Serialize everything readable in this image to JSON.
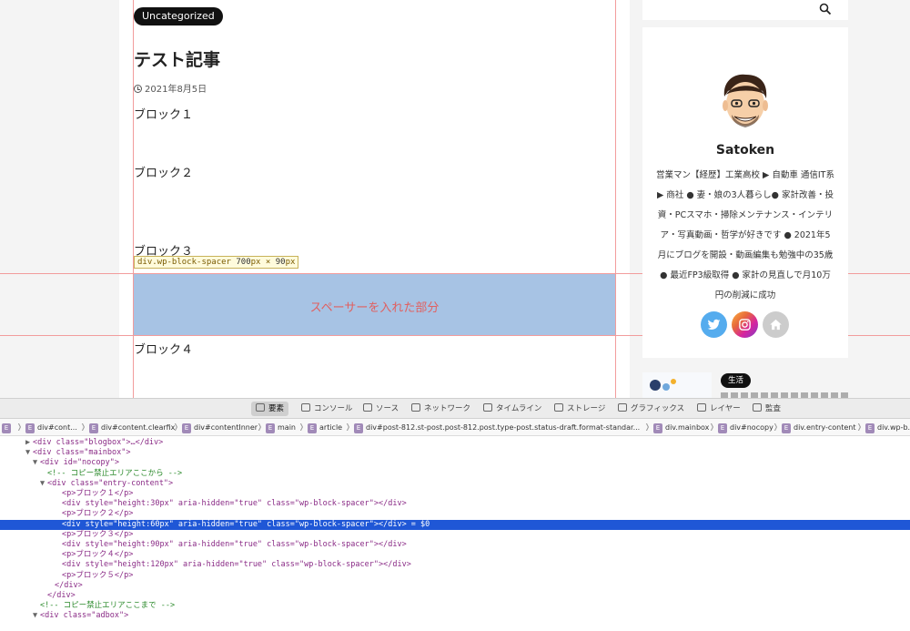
{
  "post": {
    "category": "Uncategorized",
    "title": "テスト記事",
    "date": "2021年8月5日",
    "blocks": [
      "ブロック１",
      "ブロック２",
      "ブロック３",
      "ブロック４"
    ]
  },
  "overlay": {
    "tooltip_selector": "div.wp-block-spacer",
    "tooltip_width": "700",
    "tooltip_height": "90",
    "tooltip_unit": "px",
    "tooltip_times": "×",
    "spacer_label": "スペーサーを入れた部分"
  },
  "sidebar": {
    "profile_name": "Satoken",
    "profile_bio": "営業マン【経歴】工業高校 ▶ 自動車 通信IT系 ▶ 商社 ● 妻・娘の3人暮らし● 家計改善・投資・PCスマホ・掃除メンテナンス・インテリア・写真動画・哲学が好きです ● 2021年5月にブログを開設・動画編集も勉強中の35歳 ● 最近FP3級取得 ● 家計の見直しで月10万円の削減に成功",
    "social_icons": [
      "twitter-icon",
      "instagram-icon",
      "home-icon"
    ],
    "related_badge": "生活"
  },
  "devtools": {
    "tabs": [
      "要素",
      "コンソール",
      "ソース",
      "ネットワーク",
      "タイムライン",
      "ストレージ",
      "グラフィックス",
      "レイヤー",
      "監査"
    ],
    "active_tab": "要素",
    "breadcrumbs": [
      "div#cont...",
      "div#content.clearfix",
      "div#contentInner",
      "main",
      "article",
      "div#post-812.st-post.post-812.post.type-post.status-draft.format-standar...",
      "div.mainbox",
      "div#nocopy",
      "div.entry-content",
      "div.wp-b..."
    ],
    "dom": [
      {
        "ind": 3,
        "tw": "▶",
        "t": "<div class=\"blogbox\">…</div>",
        "k": "tag"
      },
      {
        "ind": 3,
        "tw": "▼",
        "t": "<div class=\"mainbox\">",
        "k": "tag"
      },
      {
        "ind": 4,
        "tw": "▼",
        "t": "<div id=\"nocopy\">",
        "k": "tag"
      },
      {
        "ind": 5,
        "tw": "",
        "t": "<!-- コピー禁止エリアここから -->",
        "k": "comment"
      },
      {
        "ind": 5,
        "tw": "▼",
        "t": "<div class=\"entry-content\">",
        "k": "tag"
      },
      {
        "ind": 7,
        "tw": "",
        "t": "<p>ブロック１</p>",
        "k": "tag"
      },
      {
        "ind": 7,
        "tw": "",
        "t": "<div style=\"height:30px\" aria-hidden=\"true\" class=\"wp-block-spacer\"></div>",
        "k": "tag"
      },
      {
        "ind": 7,
        "tw": "",
        "t": "<p>ブロック２</p>",
        "k": "tag"
      },
      {
        "ind": 7,
        "tw": "",
        "t": "<div style=\"height:60px\" aria-hidden=\"true\" class=\"wp-block-spacer\"></div> = $0",
        "k": "sel"
      },
      {
        "ind": 7,
        "tw": "",
        "t": "<p>ブロック３</p>",
        "k": "tag"
      },
      {
        "ind": 7,
        "tw": "",
        "t": "<div style=\"height:90px\" aria-hidden=\"true\" class=\"wp-block-spacer\"></div>",
        "k": "tag"
      },
      {
        "ind": 7,
        "tw": "",
        "t": "<p>ブロック４</p>",
        "k": "tag"
      },
      {
        "ind": 7,
        "tw": "",
        "t": "<div style=\"height:120px\" aria-hidden=\"true\" class=\"wp-block-spacer\"></div>",
        "k": "tag"
      },
      {
        "ind": 7,
        "tw": "",
        "t": "<p>ブロック５</p>",
        "k": "tag"
      },
      {
        "ind": 6,
        "tw": "",
        "t": "</div>",
        "k": "tag"
      },
      {
        "ind": 5,
        "tw": "",
        "t": "</div>",
        "k": "tag"
      },
      {
        "ind": 4,
        "tw": "",
        "t": "<!-- コピー禁止エリアここまで -->",
        "k": "comment"
      },
      {
        "ind": 4,
        "tw": "▼",
        "t": "<div class=\"adbox\">",
        "k": "tag"
      }
    ]
  },
  "colors": {
    "highlight": "#a7c3e4",
    "selection": "#1f57d6",
    "guide": "#f29c9c",
    "twitter": "#55acee",
    "instagram": "#d6249f",
    "home": "#cccccc"
  }
}
